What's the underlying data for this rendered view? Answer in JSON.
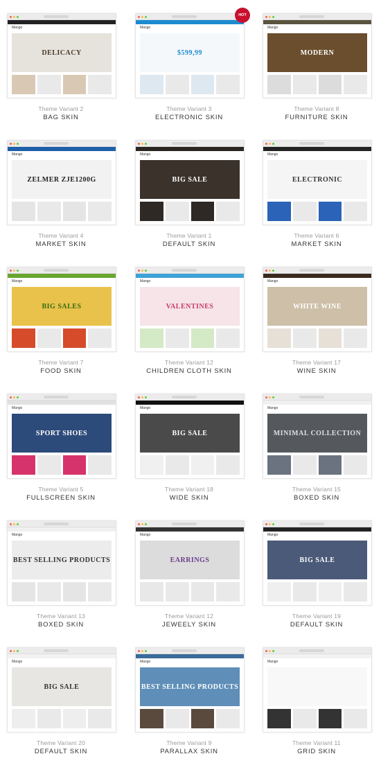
{
  "variant_prefix": "Theme Variant",
  "skins": [
    {
      "variant": "Theme Variant 2",
      "name": "BAG SKIN",
      "headline": "DELICACY",
      "nav": "#222222",
      "hero": "#e6e2dc",
      "ink": "#4a3a2a",
      "tile": "#d9c9b4"
    },
    {
      "variant": "Theme Variant 3",
      "name": "ELECTRONIC SKIN",
      "headline": "$599,99",
      "nav": "#1c8bd0",
      "hero": "#f4f8fb",
      "ink": "#1c8bd0",
      "tile": "#dde8f0",
      "badge": "HOT"
    },
    {
      "variant": "Theme Variant 8",
      "name": "FURNITURE SKIN",
      "headline": "MODERN",
      "nav": "#5a5440",
      "hero": "#6b4e2e",
      "ink": "#ffffff",
      "tile": "#dcdcdc"
    },
    {
      "variant": "Theme Variant 4",
      "name": "MARKET SKIN",
      "headline": "ZELMER ZJE1200G",
      "nav": "#1d5fa8",
      "hero": "#f2f2f2",
      "ink": "#222222",
      "tile": "#e5e5e5"
    },
    {
      "variant": "Theme Variant 1",
      "name": "DEFAULT SKIN",
      "headline": "BIG SALE",
      "nav": "#2a2520",
      "hero": "#3a322b",
      "ink": "#ffffff",
      "tile": "#2e2924"
    },
    {
      "variant": "Theme Variant 6",
      "name": "MARKET SKIN",
      "headline": "ELECTRONIC",
      "nav": "#222222",
      "hero": "#f5f5f5",
      "ink": "#333333",
      "tile": "#2a63b8"
    },
    {
      "variant": "Theme Variant 7",
      "name": "FOOD SKIN",
      "headline": "BIG SALES",
      "nav": "#6aa531",
      "hero": "#e8c24a",
      "ink": "#3a6b14",
      "tile": "#d64b2a"
    },
    {
      "variant": "Theme Variant 12",
      "name": "CHILDREN CLOTH SKIN",
      "headline": "VALENTINES",
      "nav": "#3ea2d8",
      "hero": "#f6e4e8",
      "ink": "#c8396a",
      "tile": "#d4e9c6"
    },
    {
      "variant": "Theme Variant 17",
      "name": "WINE SKIN",
      "headline": "WHITE WINE",
      "nav": "#3a2a1e",
      "hero": "#cdbfa8",
      "ink": "#ffffff",
      "tile": "#e6e0d6"
    },
    {
      "variant": "Theme Variant 5",
      "name": "FULLSCREEN SKIN",
      "headline": "SPORT SHOES",
      "nav": "#e1e1e1",
      "hero": "#2c4a7a",
      "ink": "#ffffff",
      "tile": "#d6336c"
    },
    {
      "variant": "Theme Variant 18",
      "name": "WIDE SKIN",
      "headline": "BIG SALE",
      "nav": "#111111",
      "hero": "#4a4a4a",
      "ink": "#ffffff",
      "tile": "#f0f0f0"
    },
    {
      "variant": "Theme Variant 15",
      "name": "BOXED SKIN",
      "headline": "MINIMAL COLLECTION",
      "nav": "#f0f0f0",
      "hero": "#55595e",
      "ink": "#e0e0e0",
      "tile": "#6b7380"
    },
    {
      "variant": "Theme Variant 13",
      "name": "BOXED SKIN",
      "headline": "BEST SELLING PRODUCTS",
      "nav": "#f0f0f0",
      "hero": "#ececec",
      "ink": "#333333",
      "tile": "#e5e5e5"
    },
    {
      "variant": "Theme Variant 12",
      "name": "JEWEELY SKIN",
      "headline": "EARRINGS",
      "nav": "#333333",
      "hero": "#dcdcdc",
      "ink": "#6a3d8a",
      "tile": "#e8e8e8"
    },
    {
      "variant": "Theme Variant 19",
      "name": "DEFAULT SKIN",
      "headline": "BIG SALE",
      "nav": "#222222",
      "hero": "#4a5a78",
      "ink": "#ffffff",
      "tile": "#efefef"
    },
    {
      "variant": "Theme Variant 20",
      "name": "DEFAULT SKIN",
      "headline": "BIG SALE",
      "nav": "#f2f2f2",
      "hero": "#e8e6e2",
      "ink": "#333333",
      "tile": "#eeeeee"
    },
    {
      "variant": "Theme Variant 9",
      "name": "PARALLAX SKIN",
      "headline": "BEST SELLING PRODUCTS",
      "nav": "#3a6a9a",
      "hero": "#5f8fb8",
      "ink": "#ffffff",
      "tile": "#5a4a3e"
    },
    {
      "variant": "Theme Variant 11",
      "name": "GRID SKIN",
      "headline": "",
      "nav": "#f2f2f2",
      "hero": "#f8f8f8",
      "ink": "#333333",
      "tile": "#333333"
    }
  ],
  "logo_text": "Mango"
}
